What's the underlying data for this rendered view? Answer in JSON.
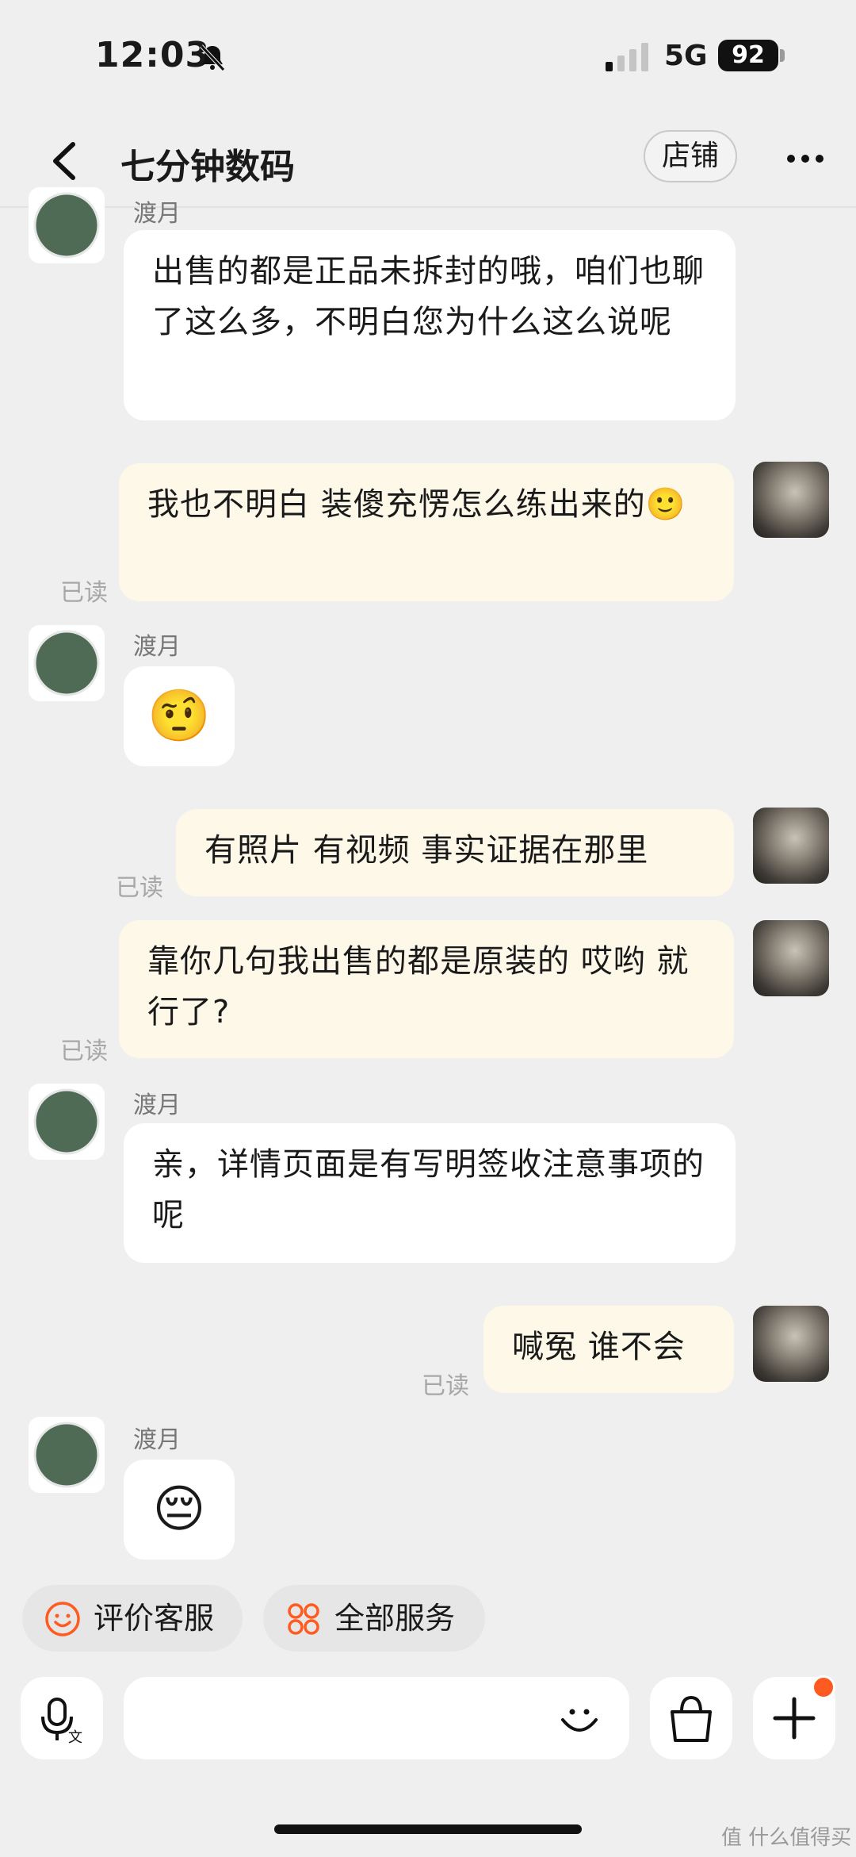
{
  "status": {
    "time": "12:03",
    "network": "5G",
    "battery": "92"
  },
  "header": {
    "title": "七分钟数码",
    "shop_label": "店铺",
    "more": "···"
  },
  "messages": {
    "m1": {
      "name": "渡月",
      "text": "出售的都是正品未拆封的哦，咱们也聊了这么多，不明白您为什么这么说呢"
    },
    "m2": {
      "text": "我也不明白 装傻充愣怎么练出来的🙂",
      "read": "已读"
    },
    "m3": {
      "name": "渡月",
      "emoji": "🤨"
    },
    "m4": {
      "text": "有照片 有视频 事实证据在那里",
      "read": "已读"
    },
    "m5": {
      "text": "靠你几句我出售的都是原装的 哎哟  就行了?",
      "read": "已读"
    },
    "m6": {
      "name": "渡月",
      "text": "亲，详情页面是有写明签收注意事项的呢"
    },
    "m7": {
      "text": "喊冤 谁不会",
      "read": "已读"
    },
    "m8": {
      "name": "渡月",
      "emoji": "😔"
    }
  },
  "actions": {
    "rate": "评价客服",
    "services": "全部服务"
  },
  "watermark": "值 什么值得买",
  "colors": {
    "accent": "#ff5a1f",
    "bubble_right": "#fdf8e8",
    "bubble_left": "#ffffff"
  },
  "icons": [
    "bell-slash-icon",
    "signal-icon",
    "back-icon",
    "more-icon",
    "voice-icon",
    "emoji-icon",
    "bag-icon",
    "plus-icon",
    "smile-icon",
    "grid-icon"
  ]
}
